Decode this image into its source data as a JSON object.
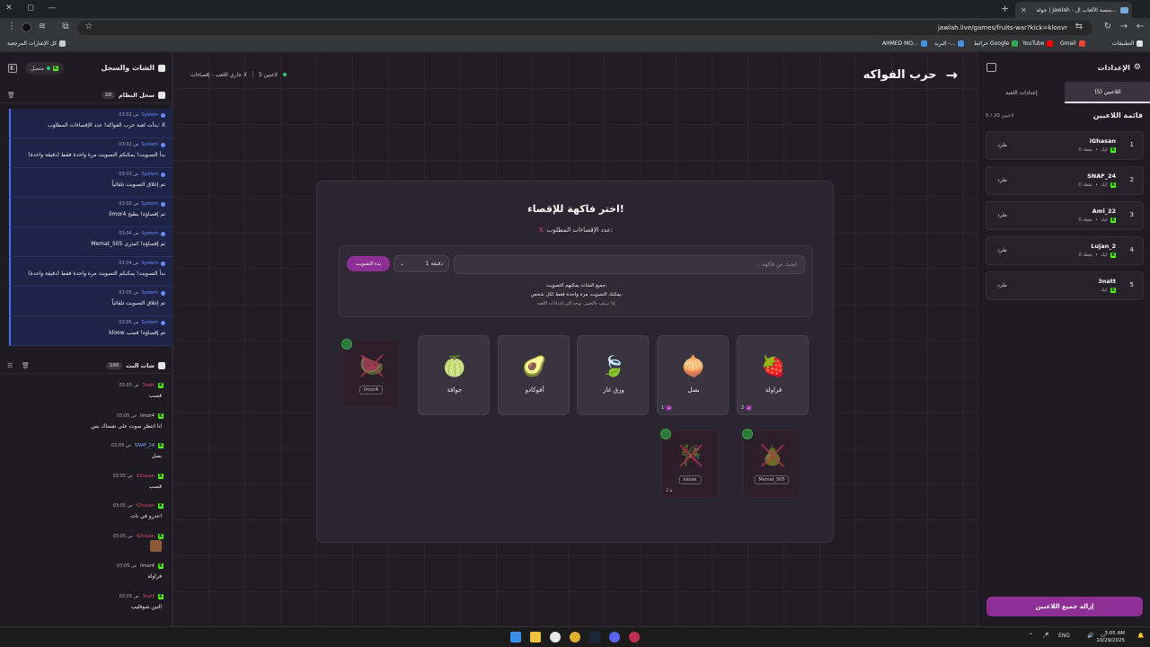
{
  "browser": {
    "tab_title": "جولة | Jawlah - منصة الألعاب ال...",
    "url": "jawlah.live/games/fruits-war?kick=kloovr",
    "bookmarks_left": "كل الإشارات المرجعية",
    "bookmarks": [
      "التطبيقات",
      "Gmail",
      "YouTube",
      "خرائط Google",
      "البريد -...",
      "AHMED MO..."
    ]
  },
  "left_panel": {
    "title": "الشات والسجل",
    "status": "متصل",
    "system_log": {
      "title": "سجل النظام",
      "count": "20",
      "entries": [
        {
          "time": "03:02 ص",
          "author": "System",
          "msg": "بدأت لعبة حرب الفواكه! عدد الإقصاءات المطلوب: X"
        },
        {
          "time": "03:02 ص",
          "author": "System",
          "msg": "بدأ التصويت! يمكنكم التصويت مرة واحدة فقط (دقيقة واحدة)"
        },
        {
          "time": "03:03 ص",
          "author": "System",
          "msg": "تم إغلاق التصويت تلقائياً"
        },
        {
          "time": "03:03 ص",
          "author": "System",
          "msg": "ilmor4 تم إقصاؤه! بطيخ"
        },
        {
          "time": "03:04 ص",
          "author": "System",
          "msg": "Memat_505 تم إقصاؤه! كمثرى"
        },
        {
          "time": "03:04 ص",
          "author": "System",
          "msg": "بدأ التصويت! يمكنكم التصويت مرة واحدة فقط (دقيقة واحدة)"
        },
        {
          "time": "03:05 ص",
          "author": "System",
          "msg": "تم إغلاق التصويت تلقائياً"
        },
        {
          "time": "03:05 ص",
          "author": "System",
          "msg": "kloow تم إقصاؤه! قصب"
        }
      ]
    },
    "bot_chat": {
      "title": "شات البث",
      "count": "100",
      "entries": [
        {
          "time": "03:05 ص",
          "author": "3natt",
          "author_color": "#e0456a",
          "msg": "قصب"
        },
        {
          "time": "03:05 ص",
          "author": "ilmor4",
          "author_color": "#cccccc",
          "msg": "انا انتظر صوت على نفساك بس"
        },
        {
          "time": "03:05 ص",
          "author": "SNAF_24",
          "author_color": "#7aa8ff",
          "msg": "بصل"
        },
        {
          "time": "03:05 ص",
          "author": "iGhasan",
          "author_color": "#e0456a",
          "msg": "قصب"
        },
        {
          "time": "03:05 ص",
          "author": "iGhasan",
          "author_color": "#e0456a",
          "msg": "اعدرو في نات"
        },
        {
          "time": "03:05 ص",
          "author": "iGhasan",
          "author_color": "#e0456a",
          "msg": ""
        },
        {
          "time": "03:05 ص",
          "author": "ilmor4",
          "author_color": "#cccccc",
          "msg": "فراولة"
        },
        {
          "time": "03:05 ص",
          "author": "3natt",
          "author_color": "#e0456a",
          "msg": "التين شوفليب"
        }
      ]
    }
  },
  "header": {
    "title": "حرب الفواكه",
    "players_online": "5 لاعبين",
    "game_state": "جاري اللعب - إقصاءات X"
  },
  "card": {
    "title": "اختر فاكهة للإقصاء!",
    "subtitle": "عدد الإقصاءات المطلوب:",
    "subtitle_x": "X",
    "search_placeholder": "ابحث عن فاكهة...",
    "duration": "1 دقيقة",
    "start_label": "بدء التصويت",
    "note1": "جميع الشات يمكنهم التصويت.",
    "note2": "يمكنك التصويت مرة واحدة فقط لكل شخص.",
    "note3": "إذا ترغب بالتغيير، توجه إلى إعدادات اللعبة.",
    "fruits": [
      {
        "name": "فراولة",
        "emoji": "🍓",
        "votes": "2"
      },
      {
        "name": "بصل",
        "emoji": "🧅",
        "votes": "1"
      },
      {
        "name": "ورق غار",
        "emoji": "🍃",
        "votes": ""
      },
      {
        "name": "أفوكادو",
        "emoji": "🥑",
        "votes": ""
      },
      {
        "name": "جوافة",
        "emoji": "🍈",
        "votes": ""
      }
    ],
    "eliminated": [
      {
        "emoji": "🍉",
        "by": "ilmor4",
        "votes": ""
      },
      {
        "emoji": "🍐",
        "by": "Memat_505",
        "votes": ""
      },
      {
        "emoji": "🎋",
        "by": "kloow",
        "votes": "2"
      }
    ]
  },
  "right_panel": {
    "title": "الإعدادات",
    "tab_players": "اللاعبين (5)",
    "tab_settings": "إعدادات اللعبة",
    "list_title": "قائمة اللاعبين",
    "list_count": "5 / 20 لاعبين",
    "kick_label": "طرد",
    "players": [
      {
        "num": "1",
        "name": "iGhasan",
        "stat": "0 نقطة"
      },
      {
        "num": "2",
        "name": "SNAF_24",
        "stat": "0 نقطة"
      },
      {
        "num": "3",
        "name": "Aml_22",
        "stat": "0 نقطة"
      },
      {
        "num": "4",
        "name": "Lujan_2",
        "stat": "0 نقطة"
      },
      {
        "num": "5",
        "name": "3natt",
        "stat": ""
      }
    ],
    "platform": "كيك",
    "remove_all": "إزالة جميع اللاعبين"
  },
  "taskbar": {
    "lang": "ENG",
    "time": "3:05 AM",
    "date": "10/29/2025"
  },
  "colors": {
    "accent": "#8e2f95",
    "kick_green": "#53fc18",
    "system_blue": "#4a6cf7"
  }
}
